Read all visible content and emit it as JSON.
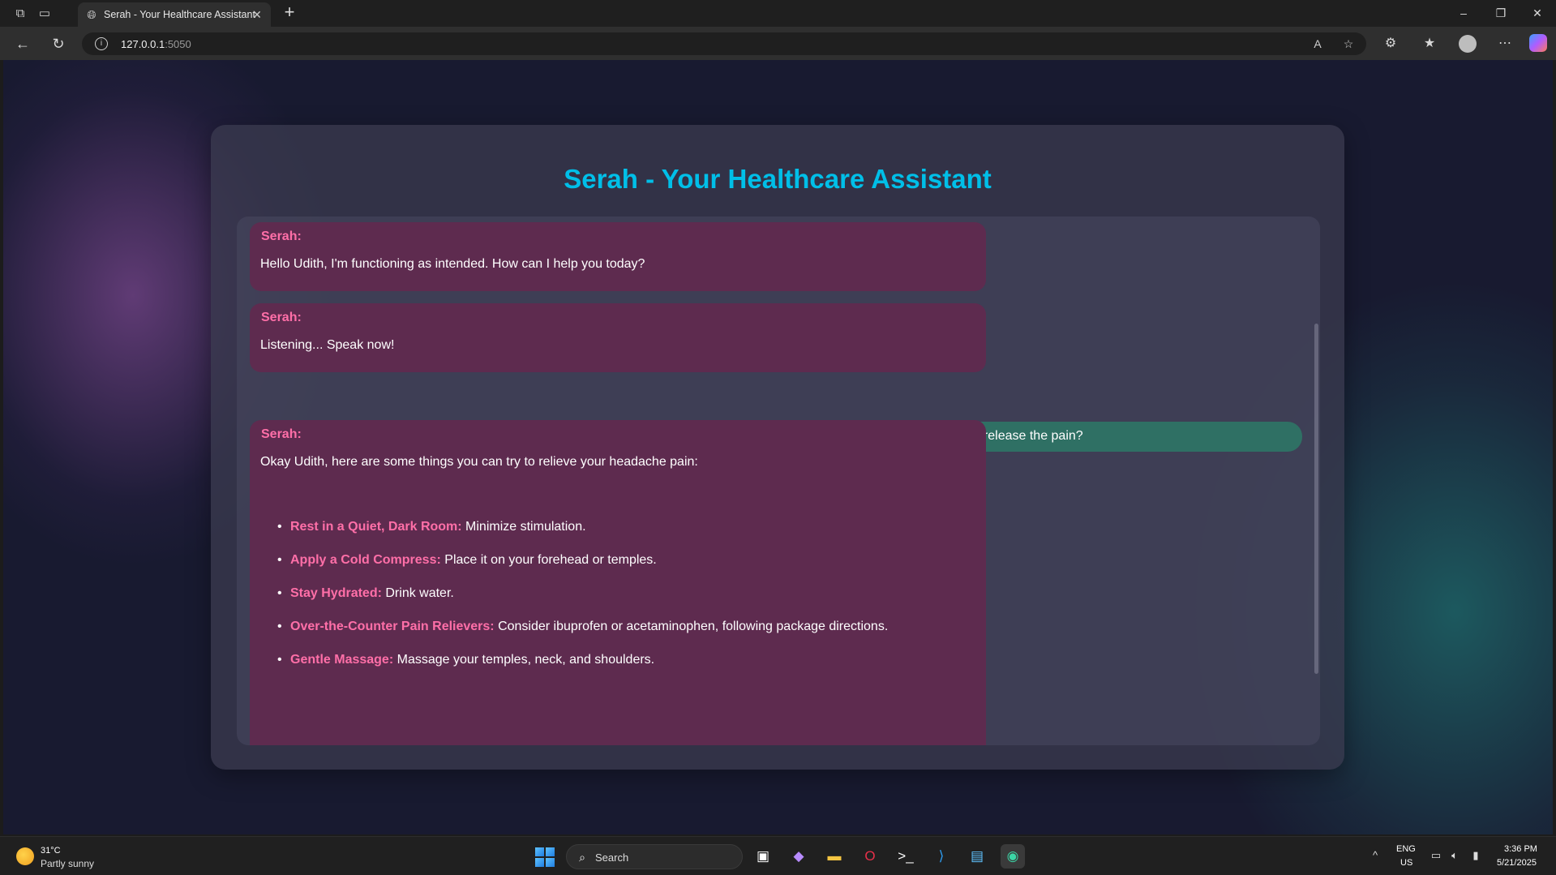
{
  "browser": {
    "tab_title": "Serah - Your Healthcare Assistant",
    "url_host": "127.0.0.1",
    "url_port": ":5050"
  },
  "page": {
    "title": "Serah - Your Healthcare Assistant"
  },
  "chat": {
    "messages": [
      {
        "sender": "Serah:",
        "text": "Hello Udith, I'm functioning as intended. How can I help you today?"
      },
      {
        "sender": "Serah:",
        "text": "Listening... Speak now!"
      },
      {
        "text": "You: Now I have a headache, so can you give me some instructions to release the pain?"
      },
      {
        "sender": "Serah:",
        "text": "Okay Udith, here are some things you can try to relieve your headache pain:",
        "tips": [
          {
            "title": "Rest in a Quiet, Dark Room:",
            "body": "Minimize stimulation."
          },
          {
            "title": "Apply a Cold Compress:",
            "body": "Place it on your forehead or temples."
          },
          {
            "title": "Stay Hydrated:",
            "body": "Drink water."
          },
          {
            "title": "Over-the-Counter Pain Relievers:",
            "body": "Consider ibuprofen or acetaminophen, following package directions."
          },
          {
            "title": "Gentle Massage:",
            "body": "Massage your temples, neck, and shoulders."
          }
        ]
      }
    ]
  },
  "taskbar": {
    "weather_temp": "31°C",
    "weather_desc": "Partly sunny",
    "search_label": "Search",
    "lang": "ENG",
    "region": "US",
    "time": "3:36 PM",
    "date": "5/21/2025"
  },
  "colors": {
    "title": "#00bfe8",
    "bot_bubble": "#5e2b4f",
    "bot_name": "#ff6fa8",
    "user_bubble": "#2f7064"
  }
}
